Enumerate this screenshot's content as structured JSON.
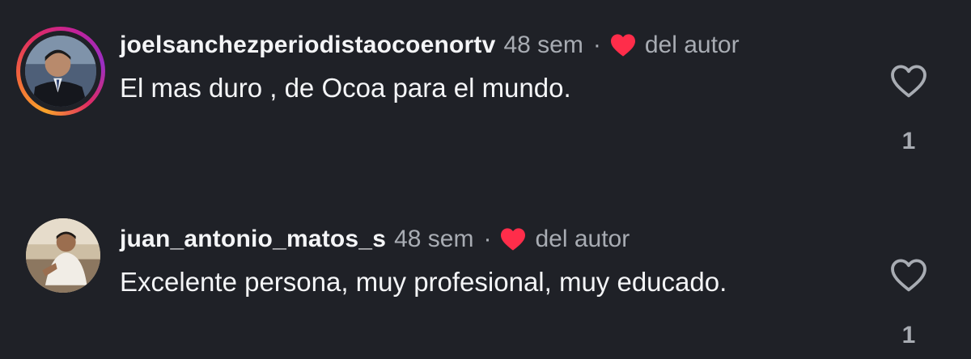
{
  "colors": {
    "background": "#1f2127",
    "author_heart": "#ff2d4a",
    "muted_text": "#a8acb3",
    "primary_text": "#f4f5f7"
  },
  "comments": [
    {
      "username": "joelsanchezperiodistaocoenortv",
      "time": "48 sem",
      "separator": "·",
      "author_like_label": "del autor",
      "text": "El mas duro , de Ocoa para el mundo.",
      "likes": "1",
      "avatar_icon": "profile-photo-icon",
      "has_story_ring": true
    },
    {
      "username": "juan_antonio_matos_s",
      "time": "48 sem",
      "separator": "·",
      "author_like_label": "del autor",
      "text": "Excelente persona, muy profesional, muy educado.",
      "likes": "1",
      "avatar_icon": "profile-photo-icon",
      "has_story_ring": false
    }
  ]
}
